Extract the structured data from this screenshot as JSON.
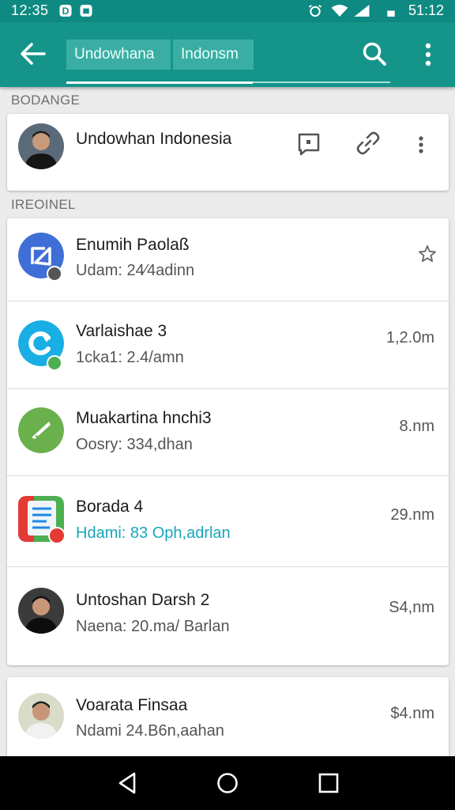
{
  "status_bar": {
    "time": "12:35",
    "right_time": "51:12"
  },
  "app_bar": {
    "tabs": [
      {
        "label": "Undowhana"
      },
      {
        "label": "Indonsm"
      }
    ]
  },
  "sections": {
    "first": "BODANGE",
    "second": "IREOINEL"
  },
  "contact": {
    "name": "Undowhan Indonesia"
  },
  "list": [
    {
      "title": "Enumih Paolaß",
      "subtitle": "Udam: 24⁄4adinn",
      "meta": "",
      "starred": true
    },
    {
      "title": "Varlaishae 3",
      "subtitle": "1cka1: 2.4/amn",
      "meta": "1,2.0m"
    },
    {
      "title": "Muakartina hnchi3",
      "subtitle": "Oosry: 334,dhan",
      "meta": "8.nm"
    },
    {
      "title": "Borada 4",
      "subtitle": "Hdami: 83 Oph,adrlan",
      "meta": "29.nm",
      "accent": true
    },
    {
      "title": "Untoshan Darsh 2",
      "subtitle": "Naena: 20.ma/ Barlan",
      "meta": "S4,nm"
    }
  ],
  "last_item": {
    "title": "Voarata Finsaa",
    "subtitle": "Ndami 24.B6n,aahan",
    "meta": "$4.nm"
  },
  "colors": {
    "primary": "#15948a",
    "status": "#0f8a82",
    "accent_text": "#17a7b9"
  }
}
